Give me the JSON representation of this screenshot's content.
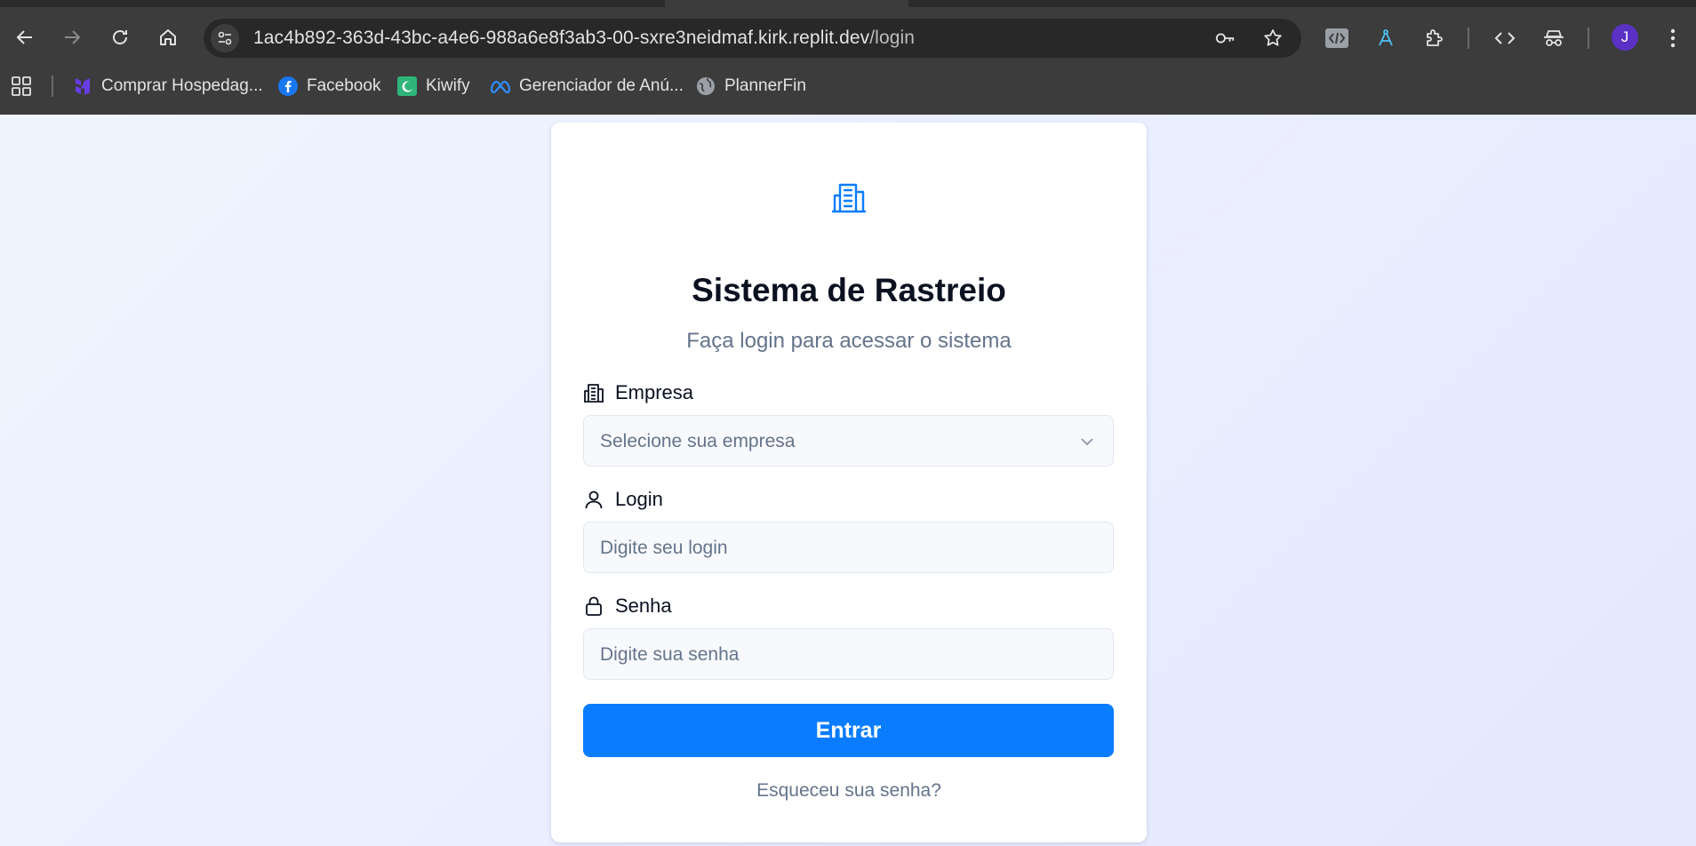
{
  "browser": {
    "url_host": "1ac4b892-363d-43bc-a4e6-988a6e8f3ab3-00-sxre3neidmaf.kirk.replit.dev",
    "url_path": "/login",
    "profile_initial": "J",
    "bookmarks": [
      {
        "label": "Comprar Hospedag...",
        "icon": "hostinger-icon"
      },
      {
        "label": "Facebook",
        "icon": "facebook-icon"
      },
      {
        "label": "Kiwify",
        "icon": "kiwify-icon"
      },
      {
        "label": "Gerenciador de Anú...",
        "icon": "meta-icon"
      },
      {
        "label": "PlannerFin",
        "icon": "globe-icon"
      }
    ]
  },
  "login": {
    "logo_icon": "building-icon",
    "title": "Sistema de Rastreio",
    "subtitle": "Faça login para acessar o sistema",
    "company": {
      "label": "Empresa",
      "placeholder": "Selecione sua empresa",
      "icon": "building-icon"
    },
    "login_field": {
      "label": "Login",
      "placeholder": "Digite seu login",
      "icon": "user-icon"
    },
    "password_field": {
      "label": "Senha",
      "placeholder": "Digite sua senha",
      "icon": "lock-icon"
    },
    "submit_label": "Entrar",
    "forgot_label": "Esqueceu sua senha?"
  },
  "colors": {
    "accent": "#0a7cff",
    "page_background": "#eaf0fd",
    "chrome": "#3c3c3c"
  }
}
